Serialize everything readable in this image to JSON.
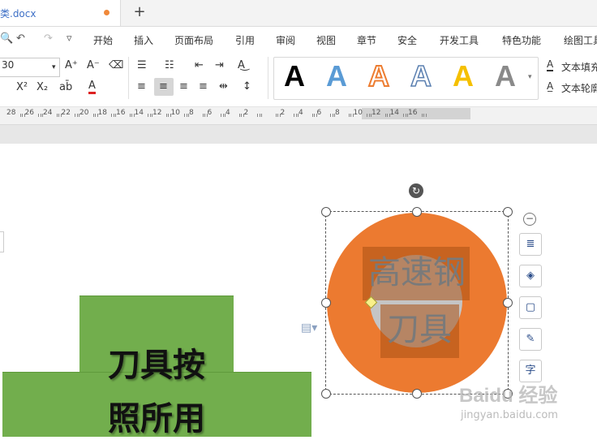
{
  "tab": {
    "title": "类.docx",
    "new_tab": "+"
  },
  "quick_access": {
    "find": "🔍",
    "undo": "↶",
    "redo": "↷",
    "more": "▿"
  },
  "menu": [
    "开始",
    "插入",
    "页面布局",
    "引用",
    "审阅",
    "视图",
    "章节",
    "安全",
    "开发工具",
    "特色功能",
    "绘图工具"
  ],
  "ribbon": {
    "font_size": "30",
    "font_size_dropdown": "▾",
    "grow_font": "A⁺",
    "shrink_font": "A⁻",
    "clear_format": "⌫",
    "superscript": "X²",
    "subscript": "X₂",
    "phonetic": "ab̄",
    "font_color": "A",
    "bullets": "☰",
    "numbering": "☷",
    "outdent": "⇤",
    "indent": "⇥",
    "text_direction": "A͜",
    "align_left": "≡",
    "align_center": "≡",
    "align_right": "≡",
    "justify": "≡",
    "distribute": "⇹",
    "line_spacing": "↕",
    "text_styles": [
      {
        "glyph": "A",
        "color": "#000000"
      },
      {
        "glyph": "A",
        "color": "#5a9bd5"
      },
      {
        "glyph": "A",
        "color": "#ed7d31"
      },
      {
        "glyph": "A",
        "color": "#ffffff"
      },
      {
        "glyph": "A",
        "color": "#f5c000"
      },
      {
        "glyph": "A",
        "color": "#8a8a8a"
      }
    ],
    "gallery_more": "▾",
    "text_fill": "文本填充",
    "text_outline": "文本轮廓"
  },
  "ruler": [
    "28",
    "26",
    "24",
    "22",
    "20",
    "18",
    "16",
    "14",
    "12",
    "10",
    "8",
    "6",
    "4",
    "2",
    "",
    "2",
    "4",
    "6",
    "8",
    "10",
    "12",
    "14",
    "16"
  ],
  "shapes": {
    "green_text_line1": "刀具按",
    "green_text_line2": "照所用",
    "donut_text_line1": "高速钢",
    "donut_text_line2": "刀具",
    "donut_color": "#ec7a30",
    "green_color": "#72ae4d"
  },
  "float_toolbar": {
    "collapse": "−",
    "layout": "≣",
    "fill": "◈",
    "outline": "▢",
    "effects": "✎",
    "text": "字"
  },
  "watermark": {
    "main": "Baidu 经验",
    "sub": "jingyan.baidu.com"
  }
}
